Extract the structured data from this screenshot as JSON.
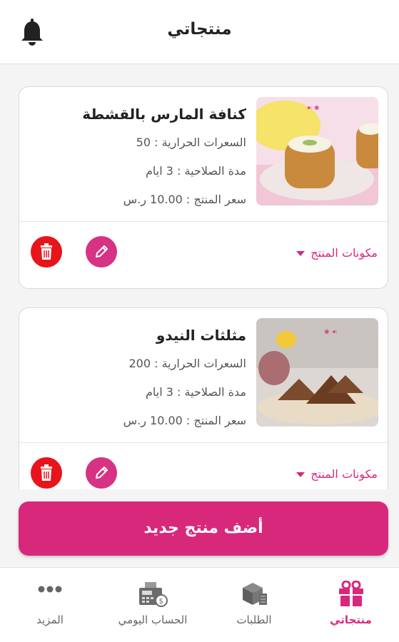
{
  "header": {
    "title": "منتجاتي",
    "bell_icon": "bell-icon"
  },
  "products": [
    {
      "name": "كنافة المارس بالقشطة",
      "calories": "السعرات الحرارية : 50",
      "shelf_life": "مدة الصلاحية : 3 ايام",
      "price": "سعر المنتج : 10.00 ر.س",
      "ingredients_label": "مكونات المنتج",
      "image_icon": "kunafa-photo"
    },
    {
      "name": "مثلثات النيدو",
      "calories": "السعرات الحرارية : 200",
      "shelf_life": "مدة الصلاحية : 3 ايام",
      "price": "سعر المنتج : 10.00 ر.س",
      "ingredients_label": "مكونات المنتج",
      "image_icon": "cake-triangles-photo"
    }
  ],
  "actions": {
    "add_product_label": "أضف منتج جديد"
  },
  "bottom_nav": {
    "items": [
      {
        "label": "منتجاتي",
        "icon": "gift-box-icon",
        "active": true
      },
      {
        "label": "الطلبات",
        "icon": "boxes-icon",
        "active": false
      },
      {
        "label": "الحساب اليومي",
        "icon": "cash-register-icon",
        "active": false
      },
      {
        "label": "المزيد",
        "icon": "more-dots-icon",
        "active": false
      }
    ]
  },
  "colors": {
    "accent": "#d8287c",
    "edit": "#d63384",
    "delete": "#e8141c"
  }
}
